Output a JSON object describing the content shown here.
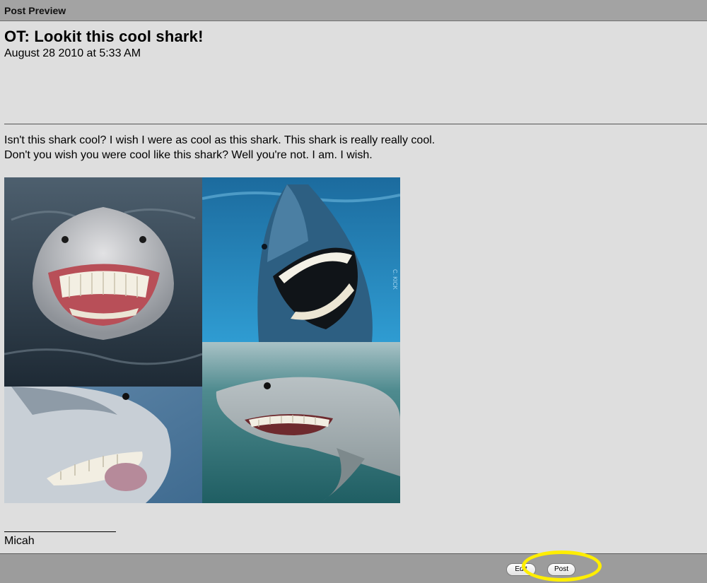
{
  "window": {
    "title": "Post Preview"
  },
  "post": {
    "title": "OT: Lookit this cool shark!",
    "date": "August 28 2010 at 5:33 AM",
    "body_line_1": "Isn't this shark cool? I wish I were as cool as this shark. This shark is really really cool.",
    "body_line_2": "Don't you wish you were cool like this shark? Well you're not. I am. I wish.",
    "signature_rule": "________________",
    "signature": "Micah"
  },
  "footer": {
    "edit_label": "Edit",
    "post_label": "Post"
  },
  "colors": {
    "titlebar": "#a3a3a3",
    "page_background": "#dedede",
    "footer": "#9c9c9c",
    "highlight": "#ffee00"
  }
}
